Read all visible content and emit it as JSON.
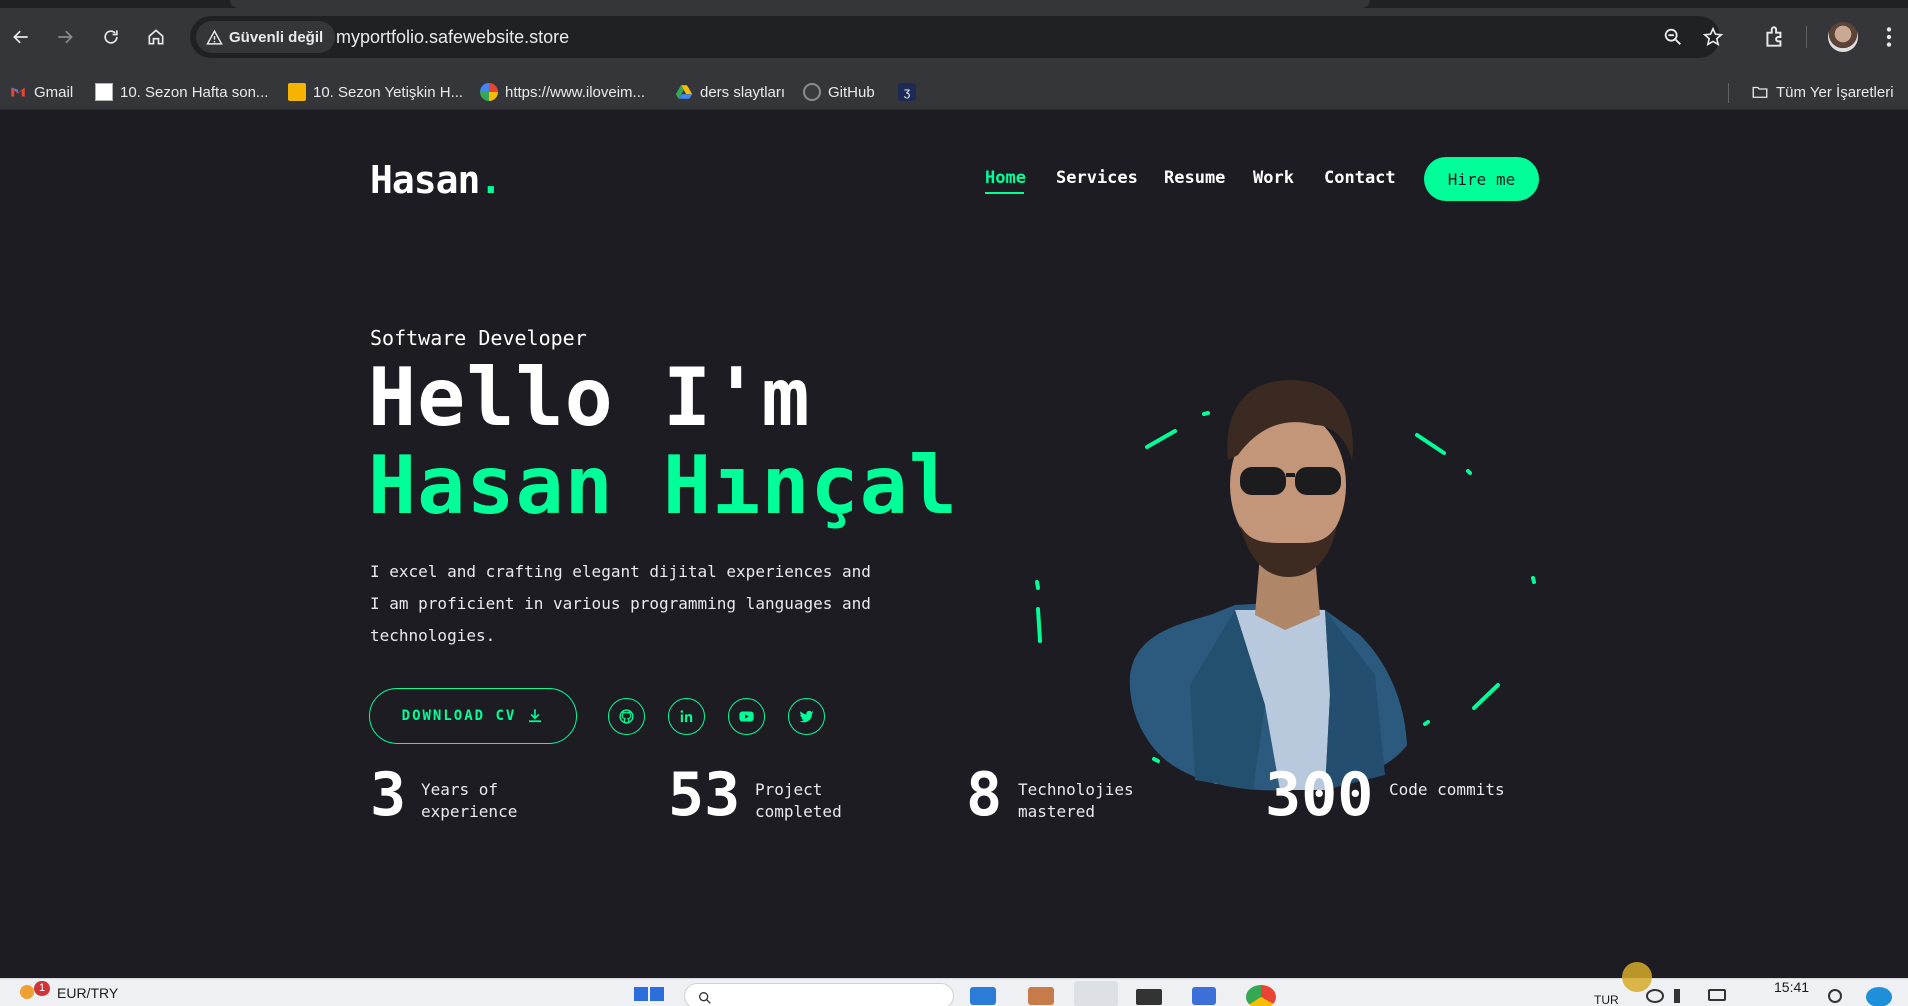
{
  "browser": {
    "security_label": "Güvenli değil",
    "url": "myportfolio.safewebsite.store",
    "bookmarks": [
      {
        "label": "Gmail",
        "icon": "gmail-icon"
      },
      {
        "label": "10. Sezon Hafta son...",
        "icon": "doc-icon"
      },
      {
        "label": "10. Sezon Yetişkin H...",
        "icon": "slides-icon"
      },
      {
        "label": "https://www.iloveim...",
        "icon": "google-icon"
      },
      {
        "label": "ders slaytları",
        "icon": "drive-icon"
      },
      {
        "label": "GitHub",
        "icon": "github-icon"
      },
      {
        "label": "",
        "icon": "app-icon"
      }
    ],
    "all_bookmarks": "Tüm Yer İşaretleri"
  },
  "site": {
    "logo": "Hasan",
    "logo_dot": ".",
    "nav": [
      "Home",
      "Services",
      "Resume",
      "Work",
      "Contact"
    ],
    "active_nav": "Home",
    "hire_button": "Hire me",
    "accent_color": "#00ff99",
    "background_color": "#1c1c22"
  },
  "hero": {
    "subtitle": "Software Developer",
    "greeting": "Hello I'm",
    "name": "Hasan Hınçal",
    "description": "I excel and crafting elegant dijital experiences and I am proficient in various programming languages and technologies.",
    "cv_button": "DOWNLOAD CV",
    "socials": [
      "github-icon",
      "linkedin-icon",
      "youtube-icon",
      "twitter-icon"
    ]
  },
  "stats": [
    {
      "number": "3",
      "label": "Years of experience"
    },
    {
      "number": "53",
      "label": "Project completed"
    },
    {
      "number": "8",
      "label": "Technolojies mastered"
    },
    {
      "number": "300",
      "label": "Code commits"
    }
  ],
  "taskbar": {
    "currency_badge": "1",
    "currency": "EUR/TRY",
    "lang": "TUR",
    "time": "15:41"
  }
}
